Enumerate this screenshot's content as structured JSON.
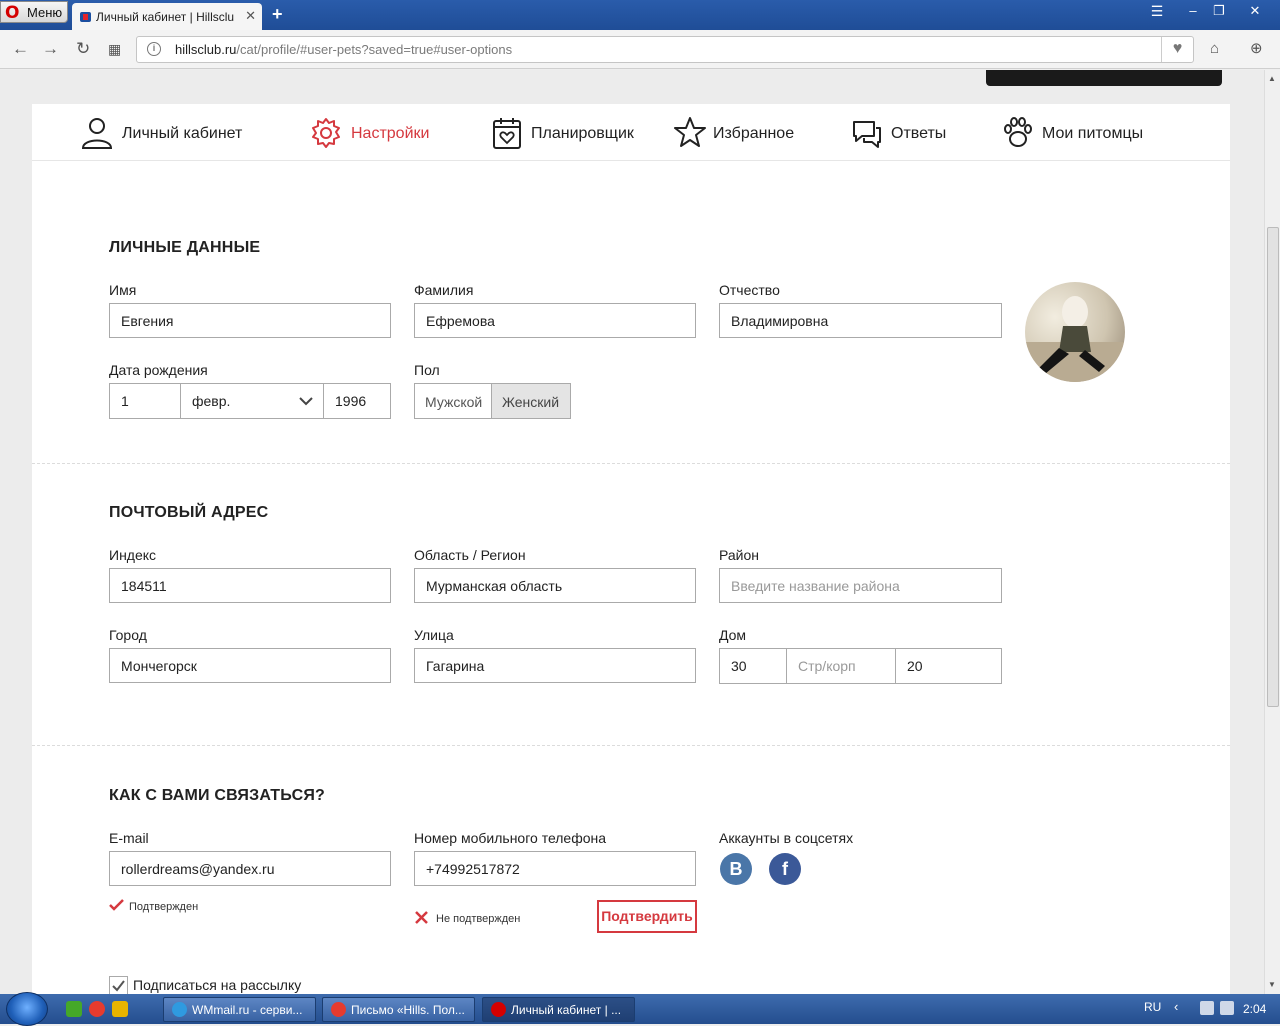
{
  "browser": {
    "menu_label": "Меню",
    "tab_title": "Личный кабинет | Hillsclu",
    "url_host": "hillsclub.ru",
    "url_path": "/cat/profile/#user-pets?saved=true#user-options"
  },
  "nav": {
    "items": [
      {
        "label": "Личный кабинет",
        "icon": "user-icon",
        "active": false
      },
      {
        "label": "Настройки",
        "icon": "gear-icon",
        "active": true
      },
      {
        "label": "Планировщик",
        "icon": "calendar-heart-icon",
        "active": false
      },
      {
        "label": "Избранное",
        "icon": "star-icon",
        "active": false
      },
      {
        "label": "Ответы",
        "icon": "chat-bubbles-icon",
        "active": false
      },
      {
        "label": "Мои питомцы",
        "icon": "paw-icon",
        "active": false
      }
    ]
  },
  "personal": {
    "title": "ЛИЧНЫЕ ДАННЫЕ",
    "first_name_label": "Имя",
    "first_name": "Евгения",
    "last_name_label": "Фамилия",
    "last_name": "Ефремова",
    "middle_name_label": "Отчество",
    "middle_name": "Владимировна",
    "birth_label": "Дата рождения",
    "birth_day": "1",
    "birth_month": "февр.",
    "birth_year": "1996",
    "gender_label": "Пол",
    "gender_male": "Мужской",
    "gender_female": "Женский",
    "gender_selected": "Женский"
  },
  "address": {
    "title": "ПОЧТОВЫЙ АДРЕС",
    "index_label": "Индекс",
    "index": "184511",
    "region_label": "Область / Регион",
    "region": "Мурманская область",
    "district_label": "Район",
    "district_placeholder": "Введите название района",
    "city_label": "Город",
    "city": "Мончегорск",
    "street_label": "Улица",
    "street": "Гагарина",
    "house_label": "Дом",
    "house": "30",
    "building_placeholder": "Стр/корп",
    "apartment": "20"
  },
  "contact": {
    "title": "КАК С ВАМИ СВЯЗАТЬСЯ?",
    "email_label": "E-mail",
    "email": "rollerdreams@yandex.ru",
    "email_status": "Подтвержден",
    "phone_label": "Номер мобильного телефона",
    "phone": "+74992517872",
    "phone_status": "Не подтвержден",
    "confirm_button": "Подтвердить",
    "social_label": "Аккаунты в соцсетях",
    "social_vk": "B",
    "social_fb": "f",
    "subscribe_label": "Подписаться на рассылку",
    "subscribe_checked": true
  },
  "colors": {
    "accent": "#d5393f",
    "vk": "#4a76a8",
    "facebook": "#3b5998"
  },
  "taskbar": {
    "tasks": [
      {
        "label": "WMmail.ru - серви..."
      },
      {
        "label": "Письмо «Hills. Пол..."
      },
      {
        "label": "Личный кабинет | ..."
      }
    ],
    "lang": "RU",
    "clock": "2:04"
  }
}
